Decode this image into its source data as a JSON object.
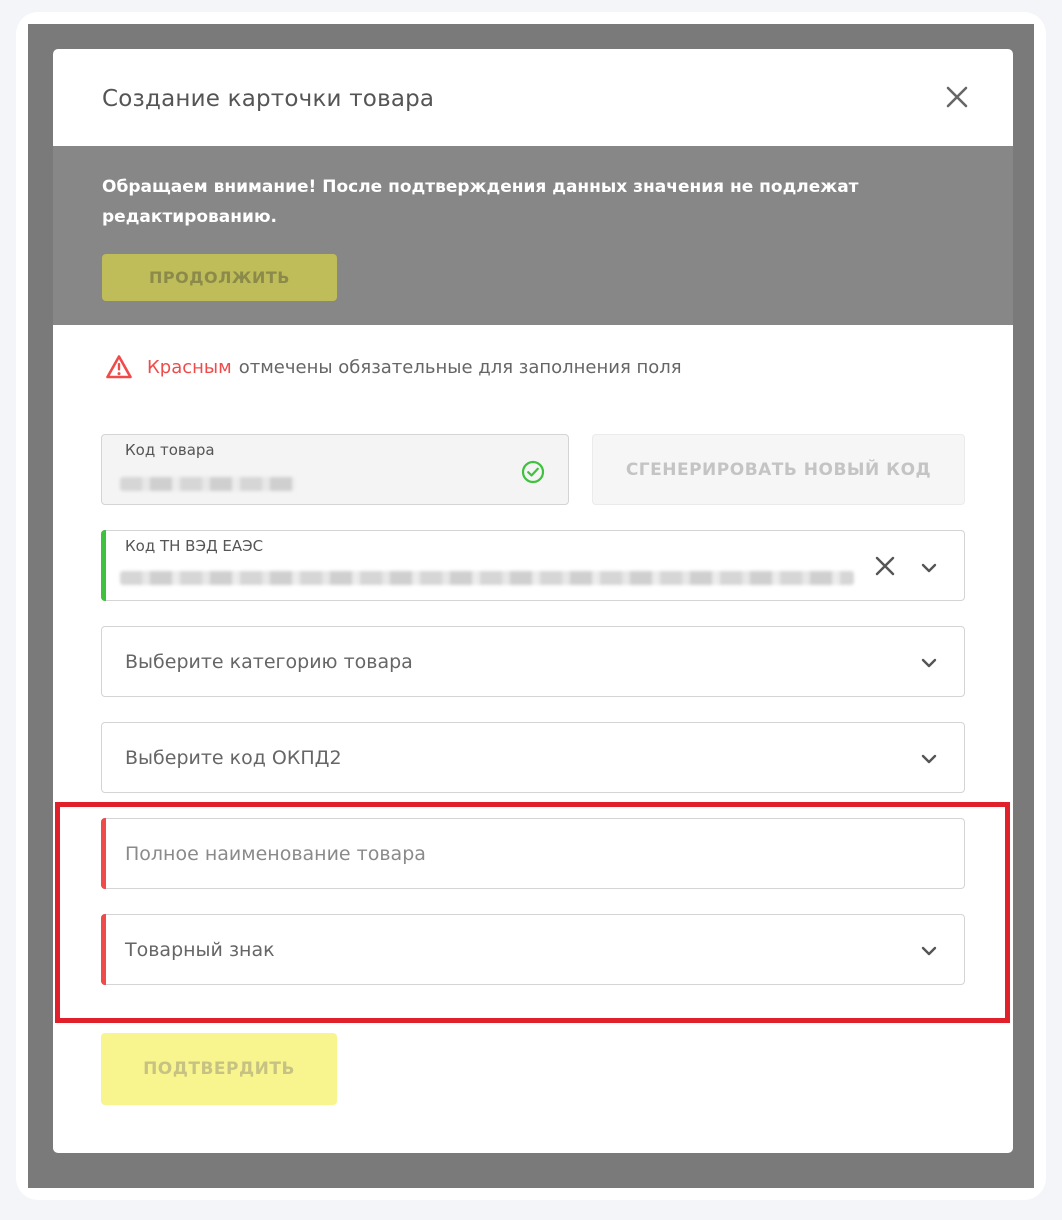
{
  "modal": {
    "title": "Создание карточки товара"
  },
  "notice": {
    "text": "Обращаем внимание! После подтверждения данных значения не подлежат редактированию.",
    "continue_label": "ПРОДОЛЖИТЬ"
  },
  "required_note": {
    "red_word": "Красным",
    "rest": "отмечены обязательные для заполнения поля"
  },
  "fields": {
    "product_code": {
      "label": "Код товара",
      "status_icon": "check-circle-icon"
    },
    "generate_label": "СГЕНЕРИРОВАТЬ НОВЫЙ КОД",
    "tnved": {
      "label": "Код ТН ВЭД ЕАЭС"
    },
    "category": {
      "placeholder": "Выберите категорию товара"
    },
    "okpd2": {
      "placeholder": "Выберите код ОКПД2"
    },
    "full_name": {
      "placeholder": "Полное наименование товара"
    },
    "trademark": {
      "placeholder": "Товарный знак"
    }
  },
  "confirm_label": "ПОДТВЕРДИТЬ",
  "colors": {
    "required_accent": "#ef4b4b",
    "valid_accent": "#3ec23e",
    "highlight_border": "#e0202a",
    "continue_button": "#bfbd5a",
    "confirm_button": "#f8f58e"
  }
}
